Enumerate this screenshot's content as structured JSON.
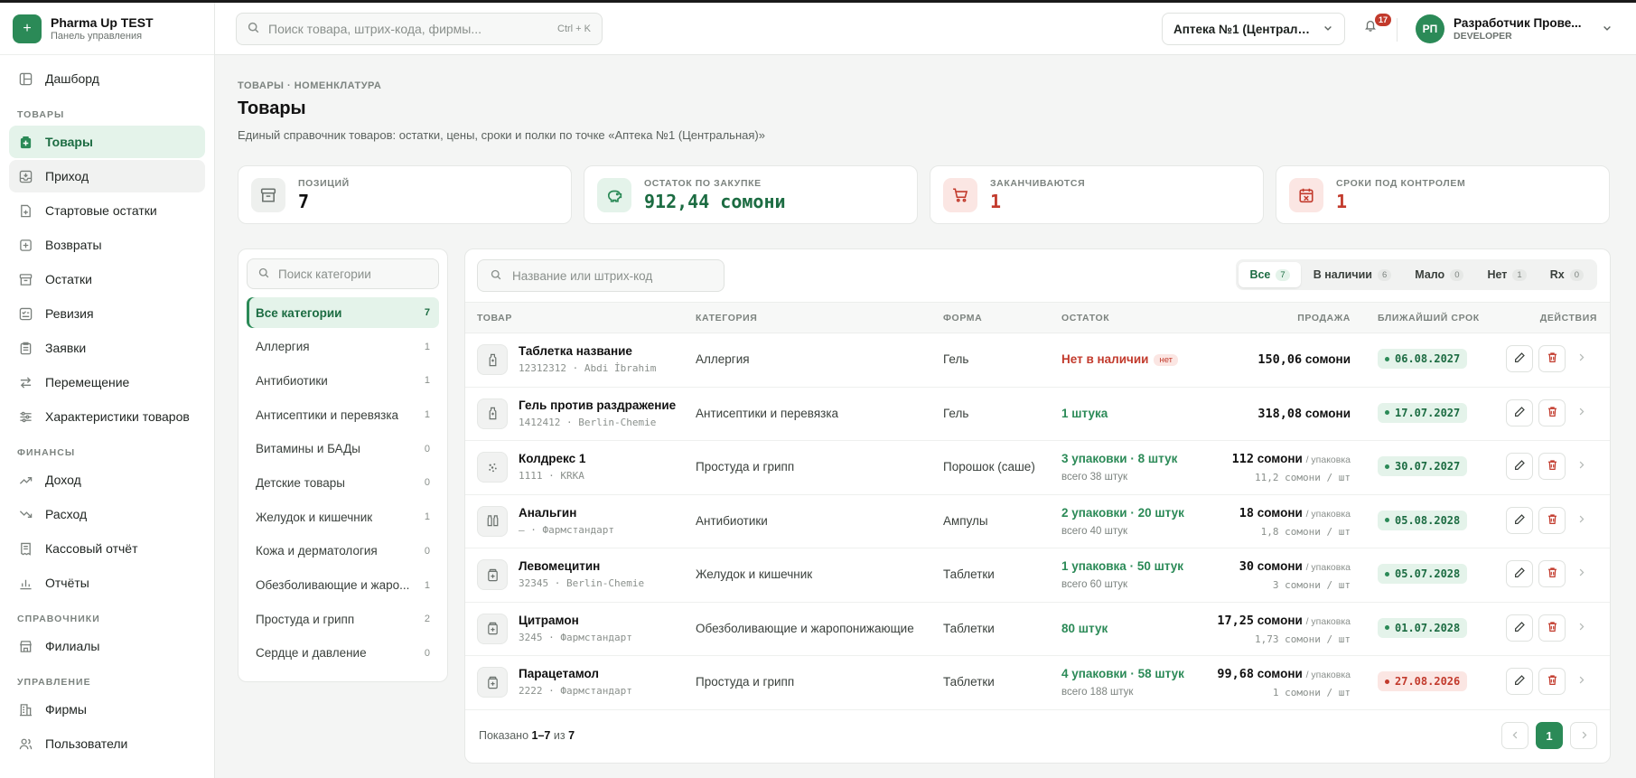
{
  "brand": {
    "title": "Pharma Up TEST",
    "subtitle": "Панель управления"
  },
  "sidebar": {
    "dashboard": "Дашборд",
    "sections": [
      {
        "title": "ТОВАРЫ",
        "items": [
          "Товары",
          "Приход",
          "Стартовые остатки",
          "Возвраты",
          "Остатки",
          "Ревизия",
          "Заявки",
          "Перемещение",
          "Характеристики товаров"
        ]
      },
      {
        "title": "ФИНАНСЫ",
        "items": [
          "Доход",
          "Расход",
          "Кассовый отчёт",
          "Отчёты"
        ]
      },
      {
        "title": "СПРАВОЧНИКИ",
        "items": [
          "Филиалы"
        ]
      },
      {
        "title": "УПРАВЛЕНИЕ",
        "items": [
          "Фирмы",
          "Пользователи"
        ]
      }
    ]
  },
  "topbar": {
    "search_placeholder": "Поиск товара, штрих-кода, фирмы...",
    "search_shortcut": "Ctrl + K",
    "pharmacy": "Аптека №1 (Центральн...",
    "notifications": "17",
    "user_initials": "РП",
    "user_name": "Разработчик Прове...",
    "user_role": "DEVELOPER"
  },
  "page": {
    "breadcrumb": "ТОВАРЫ · НОМЕНКЛАТУРА",
    "title": "Товары",
    "description": "Единый справочник товаров: остатки, цены, сроки и полки по точке «Аптека №1 (Центральная)»"
  },
  "kpis": [
    {
      "label": "ПОЗИЦИЙ",
      "value": "7",
      "color": "#111111",
      "icon_bg": "#eef0ee",
      "icon_color": "#6b726e"
    },
    {
      "label": "ОСТАТОК ПО ЗАКУПКЕ",
      "value": "912,44 сомони",
      "color": "#1c6c42",
      "icon_bg": "#e4f3ea",
      "icon_color": "#2b8a57"
    },
    {
      "label": "ЗАКАНЧИВАЮТСЯ",
      "value": "1",
      "color": "#c23a2c",
      "icon_bg": "#fbe6e3",
      "icon_color": "#c23a2c"
    },
    {
      "label": "СРОКИ ПОД КОНТРОЛЕМ",
      "value": "1",
      "color": "#c23a2c",
      "icon_bg": "#fbe6e3",
      "icon_color": "#c23a2c"
    }
  ],
  "categories": {
    "search_placeholder": "Поиск категории",
    "items": [
      {
        "name": "Все категории",
        "count": "7"
      },
      {
        "name": "Аллергия",
        "count": "1"
      },
      {
        "name": "Антибиотики",
        "count": "1"
      },
      {
        "name": "Антисептики и перевязка",
        "count": "1"
      },
      {
        "name": "Витамины и БАДы",
        "count": "0"
      },
      {
        "name": "Детские товары",
        "count": "0"
      },
      {
        "name": "Желудок и кишечник",
        "count": "1"
      },
      {
        "name": "Кожа и дерматология",
        "count": "0"
      },
      {
        "name": "Обезболивающие и жаро...",
        "count": "1"
      },
      {
        "name": "Простуда и грипп",
        "count": "2"
      },
      {
        "name": "Сердце и давление",
        "count": "0"
      }
    ]
  },
  "products": {
    "search_placeholder": "Название или штрих-код",
    "filters": [
      {
        "label": "Все",
        "count": "7"
      },
      {
        "label": "В наличии",
        "count": "6"
      },
      {
        "label": "Мало",
        "count": "0"
      },
      {
        "label": "Нет",
        "count": "1"
      },
      {
        "label": "Rx",
        "count": "0"
      }
    ],
    "columns": {
      "product": "ТОВАР",
      "category": "КАТЕГОРИЯ",
      "form": "ФОРМА",
      "stock": "ОСТАТОК",
      "price": "ПРОДАЖА",
      "expiry": "БЛИЖАЙШИЙ СРОК",
      "actions": "ДЕЙСТВИЯ"
    },
    "rows": [
      {
        "name": "Таблетка название",
        "sub": "12312312 · Abdi İbrahim",
        "category": "Аллергия",
        "form": "Гель",
        "stock": "Нет в наличии",
        "stock_badge": "нет",
        "stock_sub": "",
        "price": "150,06",
        "price_sub": "",
        "expiry": "06.08.2027",
        "icon": "bottle-icon"
      },
      {
        "name": "Гель против раздражение",
        "sub": "1412412 · Berlin-Chemie",
        "category": "Антисептики и перевязка",
        "form": "Гель",
        "stock": "1 штука",
        "stock_badge": "",
        "stock_sub": "",
        "price": "318,08",
        "price_sub": "",
        "expiry": "17.07.2027",
        "icon": "bottle-icon"
      },
      {
        "name": "Колдрекс 1",
        "sub": "1111 · KRKA",
        "category": "Простуда и грипп",
        "form": "Порошок (саше)",
        "stock": "3 упаковки · 8 штук",
        "stock_badge": "",
        "stock_sub": "всего 38 штук",
        "price": "112",
        "price_sub": "11,2 сомони / шт",
        "expiry": "30.07.2027",
        "icon": "powder-icon"
      },
      {
        "name": "Анальгин",
        "sub": "— · Фармстандарт",
        "category": "Антибиотики",
        "form": "Ампулы",
        "stock": "2 упаковки · 20 штук",
        "stock_badge": "",
        "stock_sub": "всего 40 штук",
        "price": "18",
        "price_sub": "1,8 сомони / шт",
        "expiry": "05.08.2028",
        "icon": "ampoule-icon"
      },
      {
        "name": "Левомецитин",
        "sub": "32345 · Berlin-Chemie",
        "category": "Желудок и кишечник",
        "form": "Таблетки",
        "stock": "1 упаковка · 50 штук",
        "stock_badge": "",
        "stock_sub": "всего 60 штук",
        "price": "30",
        "price_sub": "3 сомони / шт",
        "expiry": "05.07.2028",
        "icon": "pill-box-icon"
      },
      {
        "name": "Цитрамон",
        "sub": "3245 · Фармстандарт",
        "category": "Обезболивающие и жаропонижающие",
        "form": "Таблетки",
        "stock": "80 штук",
        "stock_badge": "",
        "stock_sub": "",
        "price": "17,25",
        "price_sub": "1,73 сомони / шт",
        "expiry": "01.07.2028",
        "icon": "pill-box-icon"
      },
      {
        "name": "Парацетамол",
        "sub": "2222 · Фармстандарт",
        "category": "Простуда и грипп",
        "form": "Таблетки",
        "stock": "4 упаковки · 58 штук",
        "stock_badge": "",
        "stock_sub": "всего 188 штук",
        "price": "99,68",
        "price_sub": "1 сомони / шт",
        "expiry": "27.08.2026",
        "icon": "pill-box-icon"
      }
    ],
    "currency": "сомони",
    "per_pack": "/ упаковка",
    "footer": {
      "prefix": "Показано",
      "range": "1–7",
      "of": "из",
      "total": "7"
    },
    "page": "1"
  }
}
